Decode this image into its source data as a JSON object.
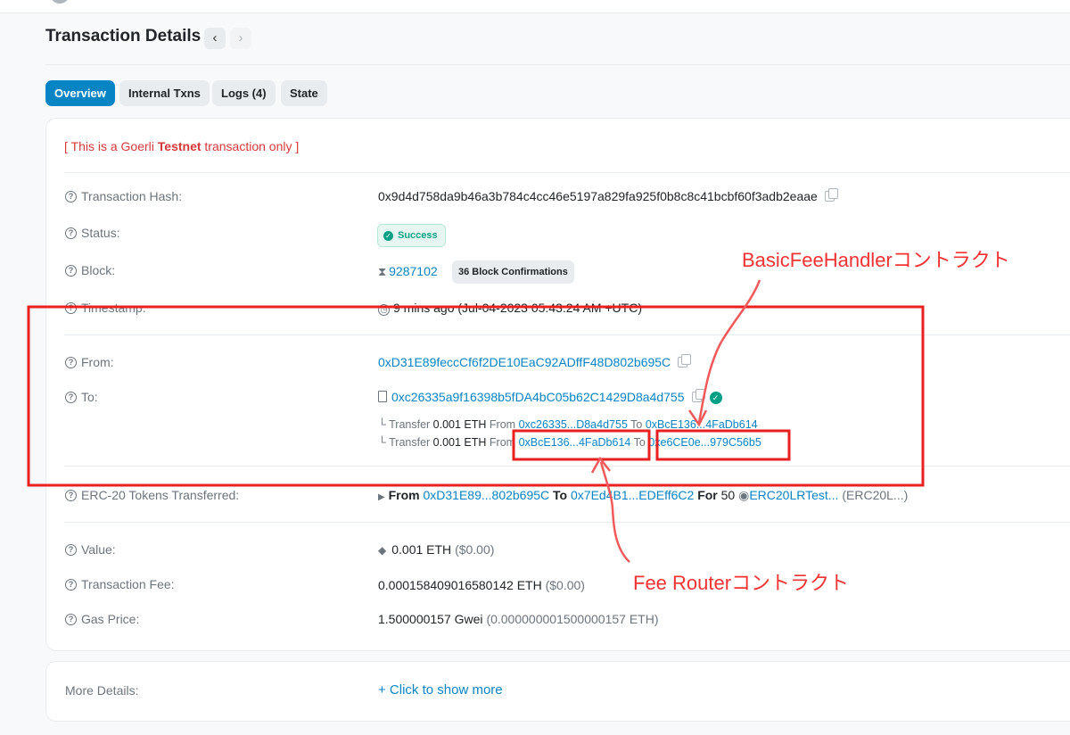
{
  "header": {
    "title": "Transaction Details",
    "prev_icon": "‹",
    "next_icon": "›"
  },
  "tabs": [
    "Overview",
    "Internal Txns",
    "Logs (4)",
    "State"
  ],
  "testnet_notice": {
    "pre": "[ This is a Goerli ",
    "bold": "Testnet",
    "post": " transaction only ]"
  },
  "rows": {
    "hash": {
      "label": "Transaction Hash:",
      "value": "0x9d4d758da9b46a3b784c4cc46e5197a829fa925f0b8c8c41bcbf60f3adb2eaae"
    },
    "status": {
      "label": "Status:",
      "badge": "Success"
    },
    "block": {
      "label": "Block:",
      "number": "9287102",
      "confirmations": "36 Block Confirmations"
    },
    "timestamp": {
      "label": "Timestamp:",
      "value": "9 mins ago (Jul-04-2023 05:43:24 AM +UTC)"
    },
    "from": {
      "label": "From:",
      "address": "0xD31E89feccCf6f2DE10EaC92ADffF48D802b695C"
    },
    "to": {
      "label": "To:",
      "address": "0xc26335a9f16398b5fDA4bC05b62C1429D8a4d755",
      "transfers": [
        {
          "prefix": "Transfer",
          "amount": "0.001 ETH",
          "from_label": "From",
          "from": "0xc26335...D8a4d755",
          "to_label": "To",
          "to": "0xBcE136...4FaDb614"
        },
        {
          "prefix": "Transfer",
          "amount": "0.001 ETH",
          "from_label": "From",
          "from": "0xBcE136...4FaDb614",
          "to_label": "To",
          "to": "0xe6CE0e...979C56b5"
        }
      ]
    },
    "erc20": {
      "label": "ERC-20 Tokens Transferred:",
      "from_label": "From",
      "from": "0xD31E89...802b695C",
      "to_label": "To",
      "to": "0x7Ed4B1...EDEff6C2",
      "for_label": "For",
      "amount": "50",
      "token": "ERC20LRTest...",
      "token_sym": "(ERC20L...)"
    },
    "value": {
      "label": "Value:",
      "amount": "0.001 ETH",
      "usd": "($0.00)"
    },
    "fee": {
      "label": "Transaction Fee:",
      "amount": "0.000158409016580142 ETH",
      "usd": "($0.00)"
    },
    "gas": {
      "label": "Gas Price:",
      "amount": "1.500000157 Gwei",
      "eth": "(0.000000001500000157 ETH)"
    }
  },
  "more": {
    "label": "More Details:",
    "link": "+ Click to show more"
  },
  "annotations": {
    "basic_fee": "BasicFeeHandlerコントラクト",
    "fee_router": "Fee Routerコントラクト"
  },
  "colors": {
    "accent": "#0784c3",
    "success": "#00a186",
    "annotation": "#f03232",
    "warning": "#d63939"
  }
}
